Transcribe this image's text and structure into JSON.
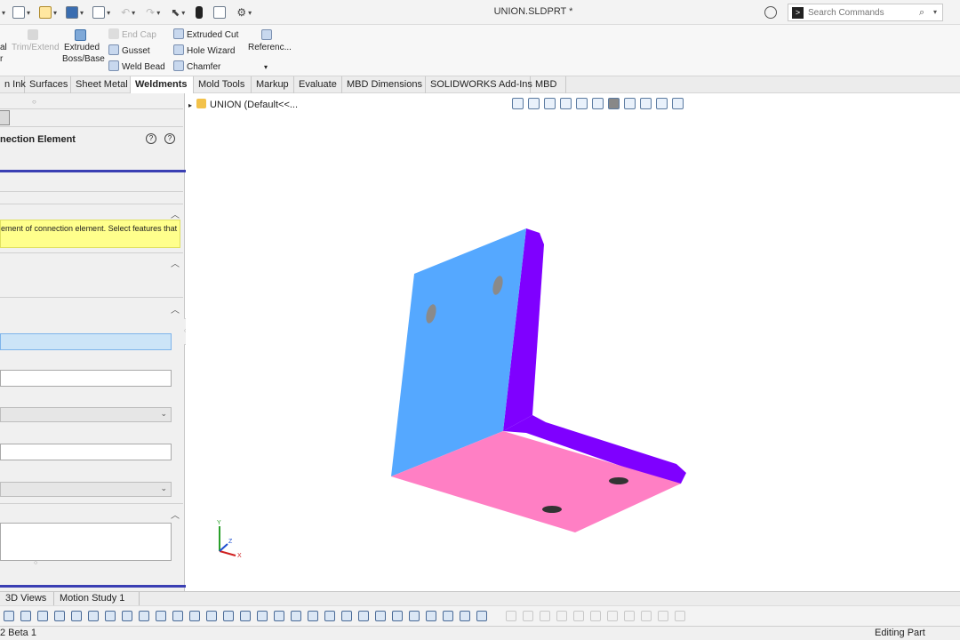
{
  "window": {
    "document_title": "UNION.SLDPRT *"
  },
  "search": {
    "placeholder": "Search Commands"
  },
  "ribbon": {
    "partial_left_top": "al",
    "partial_left_bottom": "r",
    "trim_extend": "Trim/Extend",
    "extruded_boss_line1": "Extruded",
    "extruded_boss_line2": "Boss/Base",
    "end_cap": "End Cap",
    "gusset": "Gusset",
    "weld_bead": "Weld Bead",
    "extruded_cut": "Extruded Cut",
    "hole_wizard": "Hole Wizard",
    "chamfer": "Chamfer",
    "reference": "Referenc...",
    "reference_dropdown": "▾"
  },
  "tabs": {
    "items": [
      "n Ink",
      "Surfaces",
      "Sheet Metal",
      "Weldments",
      "Mold Tools",
      "Markup",
      "Evaluate",
      "MBD Dimensions",
      "SOLIDWORKS Add-Ins",
      "MBD"
    ],
    "active": "Weldments"
  },
  "property_manager": {
    "title": "nection Element",
    "message": "ement of connection element. Select features that",
    "help_icon_1": "?",
    "help_icon_2": "?"
  },
  "feature_tree": {
    "root_label": "UNION  (Default<<..."
  },
  "bottom_tabs": [
    "3D Views",
    "Motion Study 1"
  ],
  "status": {
    "left": "2 Beta 1",
    "right": "Editing Part"
  },
  "triad": {
    "x": "X",
    "y": "Y",
    "z": "Z"
  },
  "colors": {
    "face_top": "#55a8ff",
    "face_bottom": "#ff7fc4",
    "face_side": "#7f00ff",
    "highlight_border": "#3a3fb3",
    "message_bg": "#ffff8c",
    "selected_field": "#cce4f7"
  }
}
